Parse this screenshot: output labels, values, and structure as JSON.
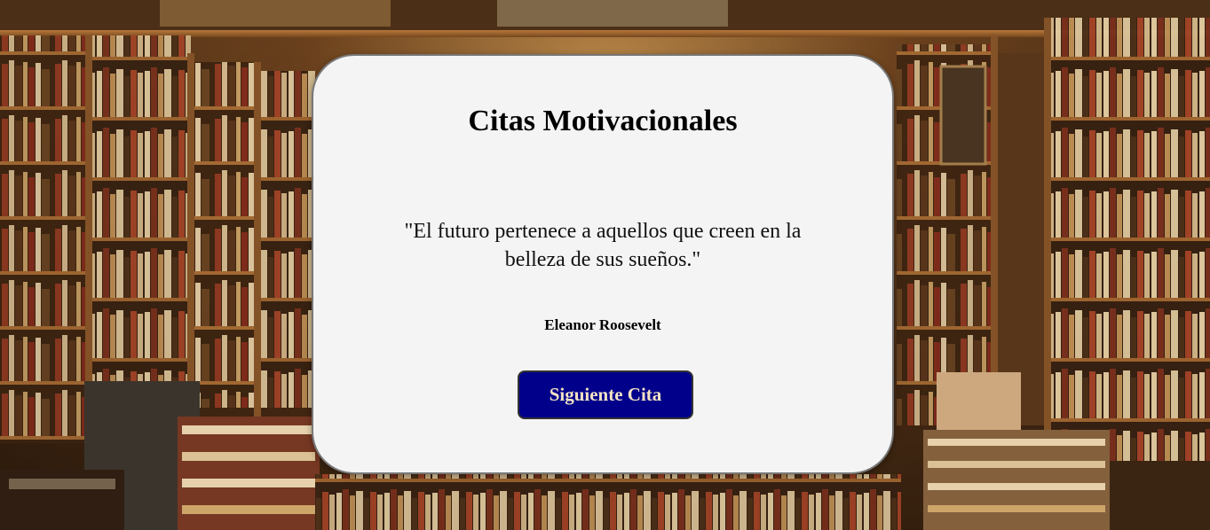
{
  "card": {
    "title": "Citas Motivacionales",
    "quote": "\"El futuro pertenece a aquellos que creen en la belleza de sus sueños.\"",
    "author": "Eleanor Roosevelt",
    "button_label": "Siguiente Cita"
  },
  "colors": {
    "card_background": "#f4f4f4",
    "button_background": "#00008b",
    "button_text": "#f3e2c4"
  }
}
